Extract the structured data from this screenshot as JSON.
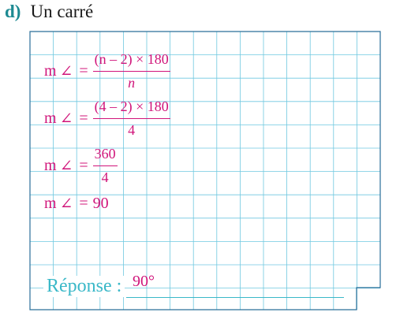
{
  "exercise": {
    "letter": "d)",
    "title": "Un carré"
  },
  "work": {
    "line1": {
      "lhs": "m",
      "symbol": "∠",
      "equals": "=",
      "numerator": "(n – 2) × 180",
      "denominator": "n"
    },
    "line2": {
      "lhs": "m",
      "symbol": "∠",
      "equals": "=",
      "numerator": "(4 – 2) × 180",
      "denominator": "4"
    },
    "line3": {
      "lhs": "m",
      "symbol": "∠",
      "equals": "=",
      "numerator": "360",
      "denominator": "4"
    },
    "line4": {
      "lhs": "m",
      "symbol": "∠",
      "equals": "=",
      "value": "90"
    }
  },
  "answer": {
    "label": "Réponse :",
    "value": "90°"
  },
  "colors": {
    "accent_teal": "#1d8a92",
    "answer_label": "#3ab8c8",
    "handwriting_magenta": "#d0147a",
    "grid_blue": "#6fc8e0",
    "grid_border": "#2a6f99"
  }
}
